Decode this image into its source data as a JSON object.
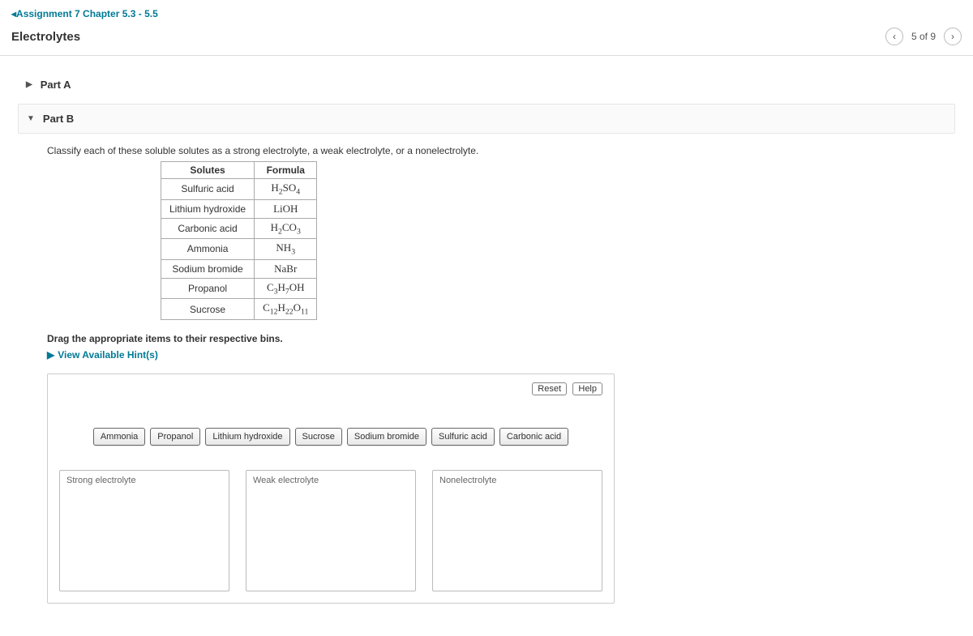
{
  "nav": {
    "back_label": "Assignment 7 Chapter 5.3 - 5.5"
  },
  "page": {
    "title": "Electrolytes"
  },
  "pager": {
    "position": "5 of 9"
  },
  "parts": {
    "a_label": "Part A",
    "b_label": "Part B"
  },
  "question": {
    "instruction": "Classify each of these soluble solutes as a strong electrolyte, a weak electrolyte, or a nonelectrolyte.",
    "table": {
      "head_solute": "Solutes",
      "head_formula": "Formula",
      "rows": [
        {
          "name": "Sulfuric acid",
          "formula_html": "H<sub>2</sub>SO<sub>4</sub>"
        },
        {
          "name": "Lithium hydroxide",
          "formula_html": "LiOH"
        },
        {
          "name": "Carbonic acid",
          "formula_html": "H<sub>2</sub>CO<sub>3</sub>"
        },
        {
          "name": "Ammonia",
          "formula_html": "NH<sub>3</sub>"
        },
        {
          "name": "Sodium bromide",
          "formula_html": "NaBr"
        },
        {
          "name": "Propanol",
          "formula_html": "C<sub>3</sub>H<sub>7</sub>OH"
        },
        {
          "name": "Sucrose",
          "formula_html": "C<sub>12</sub>H<sub>22</sub>O<sub>11</sub>"
        }
      ]
    },
    "drag_instruction": "Drag the appropriate items to their respective bins.",
    "hints_label": "View Available Hint(s)"
  },
  "activity": {
    "reset_label": "Reset",
    "help_label": "Help",
    "items": [
      "Ammonia",
      "Propanol",
      "Lithium hydroxide",
      "Sucrose",
      "Sodium bromide",
      "Sulfuric acid",
      "Carbonic acid"
    ],
    "bins": [
      "Strong electrolyte",
      "Weak electrolyte",
      "Nonelectrolyte"
    ]
  }
}
